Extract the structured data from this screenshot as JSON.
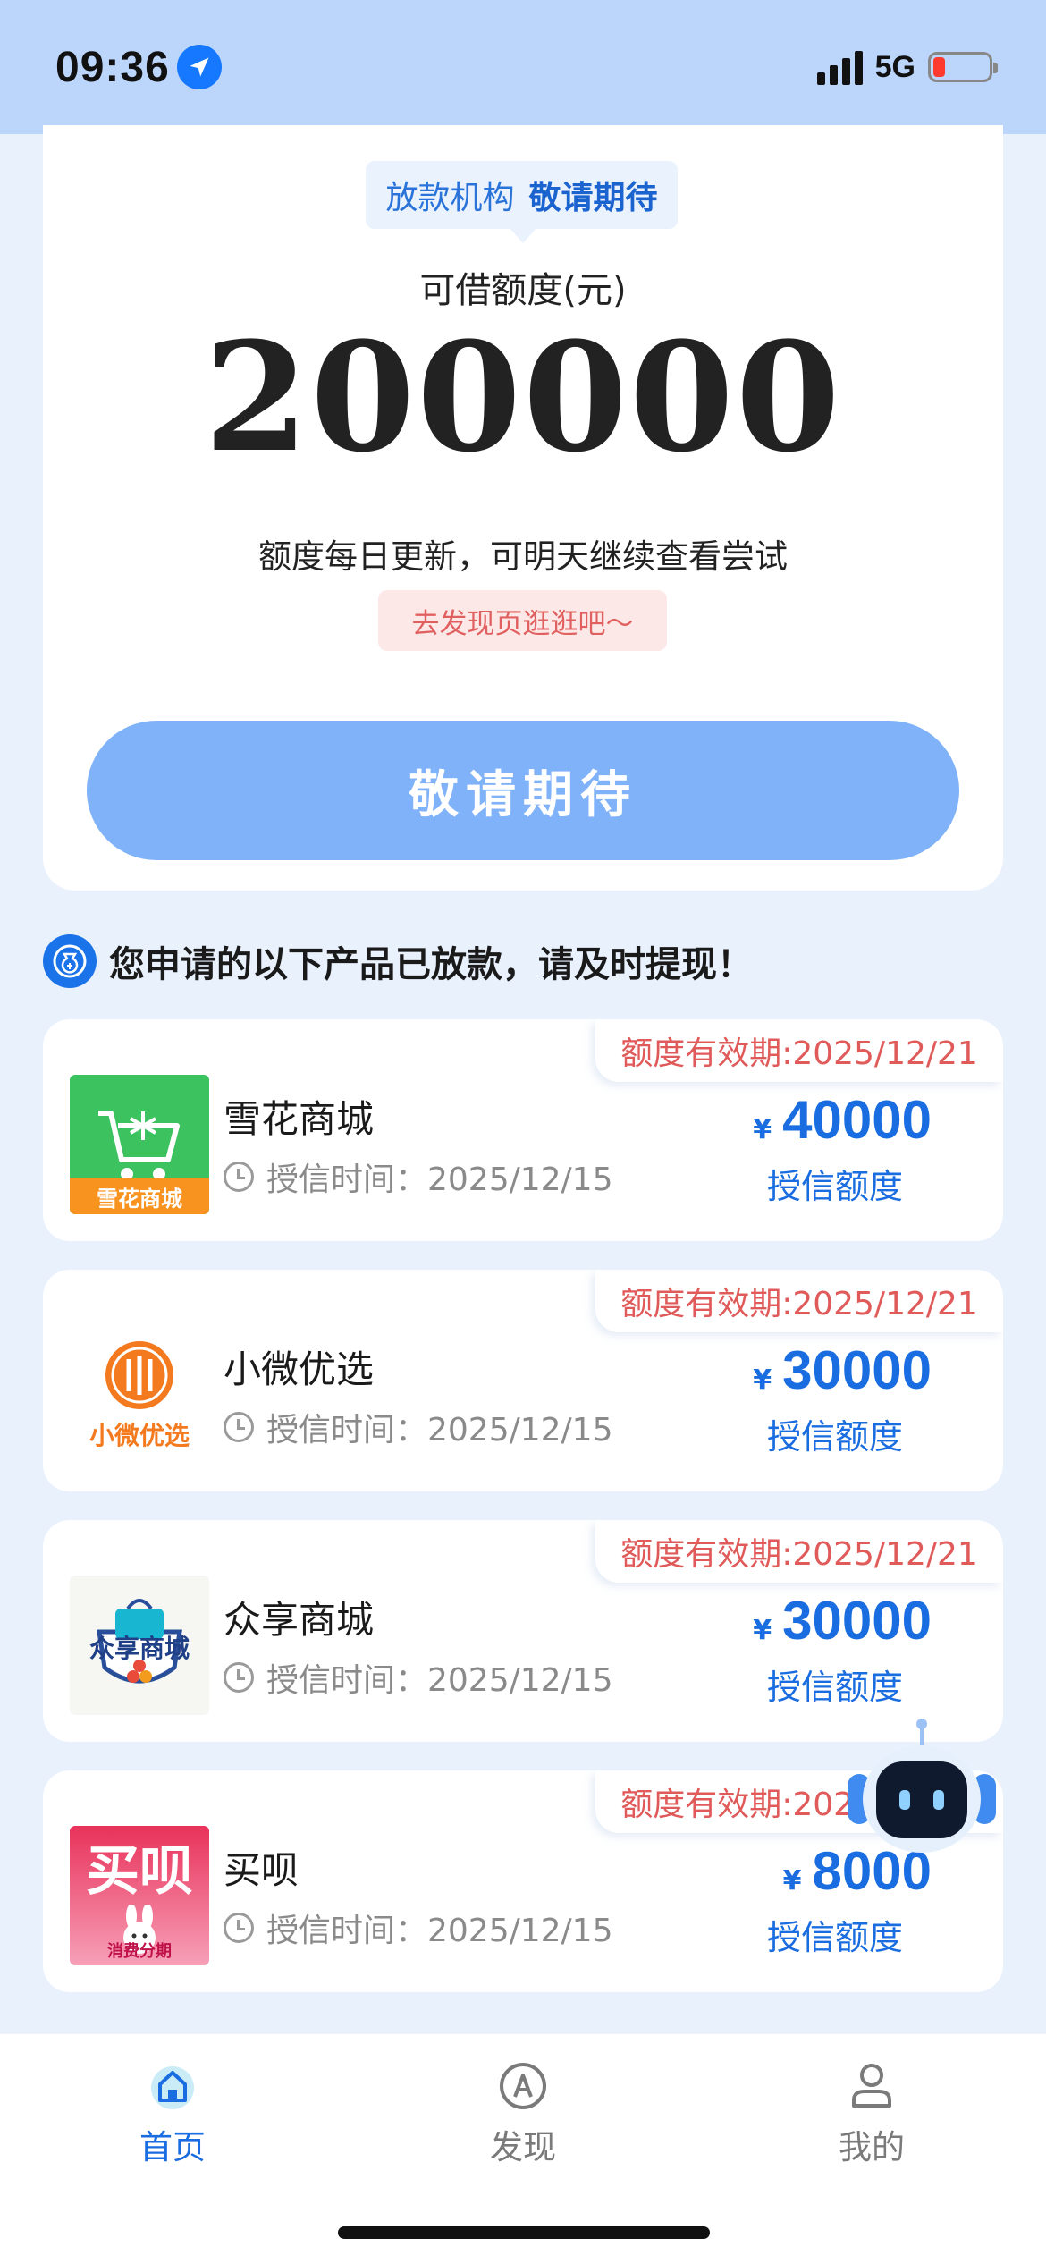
{
  "status_bar": {
    "time": "09:36",
    "network": "5G"
  },
  "top_card": {
    "lender_label": "放款机构",
    "lender_value": "敬请期待",
    "limit_label": "可借额度(元)",
    "limit_value": "200000",
    "update_note": "额度每日更新，可明天继续查看尝试",
    "discover_link": "去发现页逛逛吧～",
    "main_button": "敬请期待"
  },
  "notice": {
    "text": "您申请的以下产品已放款，请及时提现！"
  },
  "products": [
    {
      "name": "雪花商城",
      "logo_text": "雪花商城",
      "validity": "额度有效期:2025/12/21",
      "credit_time": "授信时间：2025/12/15",
      "currency": "¥",
      "amount": "40000",
      "amount_label": "授信额度"
    },
    {
      "name": "小微优选",
      "logo_text": "小微优选",
      "validity": "额度有效期:2025/12/21",
      "credit_time": "授信时间：2025/12/15",
      "currency": "¥",
      "amount": "30000",
      "amount_label": "授信额度"
    },
    {
      "name": "众享商城",
      "logo_text": "众享商城",
      "validity": "额度有效期:2025/12/21",
      "credit_time": "授信时间：2025/12/15",
      "currency": "¥",
      "amount": "30000",
      "amount_label": "授信额度"
    },
    {
      "name": "买呗",
      "logo_text": "买呗",
      "logo_subtext": "消费分期",
      "validity": "额度有效期:2025/12/21",
      "credit_time": "授信时间：2025/12/15",
      "currency": "¥",
      "amount": "8000",
      "amount_label": "授信额度"
    }
  ],
  "tabs": [
    {
      "label": "首页",
      "icon": "home-icon",
      "active": true
    },
    {
      "label": "发现",
      "icon": "compass-icon",
      "active": false
    },
    {
      "label": "我的",
      "icon": "user-icon",
      "active": false
    }
  ],
  "colors": {
    "primary": "#1a6de0",
    "button": "#7fb2f8",
    "warning": "#e05a5a",
    "status_bar": "#bcd6fb"
  }
}
